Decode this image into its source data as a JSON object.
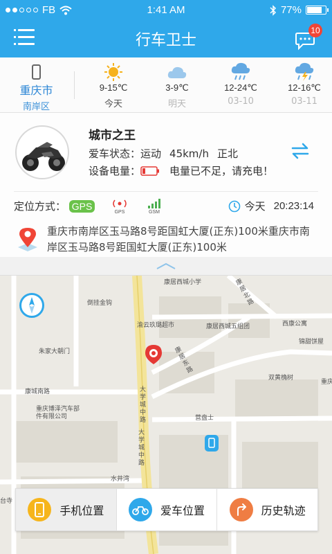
{
  "status_bar": {
    "carrier": "FB",
    "time": "1:41 AM",
    "battery": "77%"
  },
  "header": {
    "title": "行车卫士",
    "message_badge": "10"
  },
  "weather": {
    "city": "重庆市",
    "district": "南岸区",
    "days": [
      {
        "icon": "sunny-icon",
        "temp": "9-15℃",
        "label": "今天"
      },
      {
        "icon": "cloudy-icon",
        "temp": "3-9℃",
        "label": "明天"
      },
      {
        "icon": "rain-icon",
        "temp": "12-24℃",
        "label": "03-10"
      },
      {
        "icon": "thunder-rain-icon",
        "temp": "12-16℃",
        "label": "03-11"
      }
    ]
  },
  "vehicle": {
    "name": "城市之王",
    "status_label": "爱车状态：",
    "status_value": "运动",
    "speed": "45km/h",
    "direction": "正北",
    "battery_label": "设备电量：",
    "battery_warning": "电量已不足，请充电！"
  },
  "location": {
    "mode_label": "定位方式：",
    "mode": "GPS",
    "gps_label": "GPS",
    "gsm_label": "GSM",
    "date": "今天",
    "time": "20:23:14",
    "address": "重庆市南岸区玉马路8号距国虹大厦(正东)100米重庆市南岸区玉马路8号距国虹大厦(正东)100米"
  },
  "map_labels": [
    "康居西城小学",
    "倒挂金钩",
    "渝云玖璐超市",
    "康居西城五组团",
    "西康公寓",
    "锦甜饼屋",
    "朱家大朝门",
    "康城南路",
    "重庆博泽汽车部件有限公司",
    "营盘士",
    "双黄桷树",
    "重庆合",
    "大学城中路",
    "大学城中路",
    "水井湾",
    "康居北路",
    "康居东路",
    "台寺"
  ],
  "tabs": [
    {
      "label": "手机位置",
      "color": "#f6b51c"
    },
    {
      "label": "爱车位置",
      "color": "#2fa8ea"
    },
    {
      "label": "历史轨迹",
      "color": "#ef7d43"
    }
  ],
  "colors": {
    "header": "#2fa8ea",
    "badge": "#f04536",
    "gps": "#6ac24a",
    "warning": "#e53935"
  }
}
